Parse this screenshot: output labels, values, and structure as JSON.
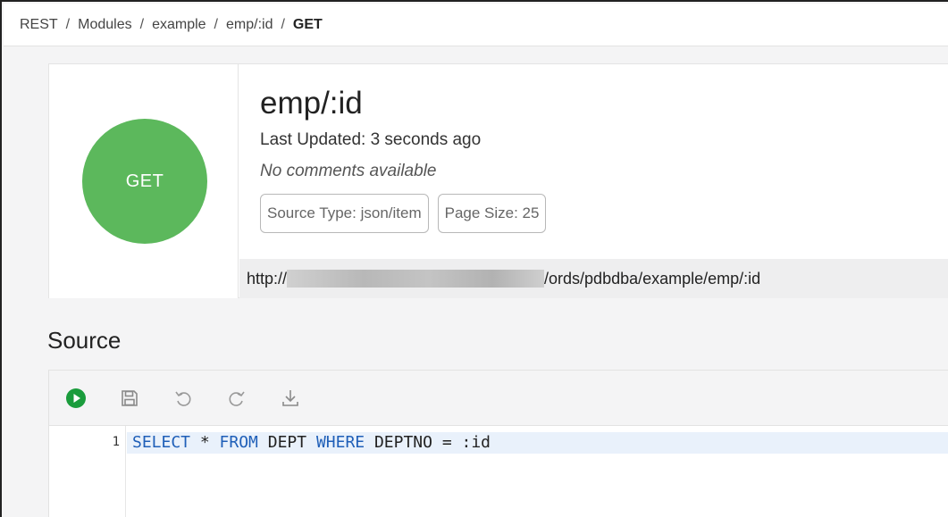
{
  "breadcrumb": {
    "items": [
      "REST",
      "Modules",
      "example",
      "emp/:id"
    ],
    "current": "GET",
    "separator": "/"
  },
  "handler": {
    "method": "GET",
    "title": "emp/:id",
    "last_updated": "Last Updated: 3 seconds ago",
    "comments": "No comments available",
    "source_type_chip": "Source Type: json/item",
    "page_size_chip": "Page Size: 25",
    "url_prefix": "http://",
    "url_suffix": "/ords/pdbdba/example/emp/:id"
  },
  "source": {
    "section_title": "Source",
    "toolbar": [
      {
        "name": "run-icon",
        "color": "#1a9c3c"
      },
      {
        "name": "save-icon"
      },
      {
        "name": "undo-icon"
      },
      {
        "name": "redo-icon"
      },
      {
        "name": "download-icon"
      }
    ],
    "line_number": "1",
    "code_tokens": {
      "t1": "SELECT",
      "t2": " * ",
      "t3": "FROM",
      "t4": " DEPT ",
      "t5": "WHERE",
      "t6": " DEPTNO = :id"
    }
  },
  "colors": {
    "method_get": "#5cb85c",
    "keyword": "#1f5fb8",
    "highlight_line": "#e9f1fb"
  }
}
